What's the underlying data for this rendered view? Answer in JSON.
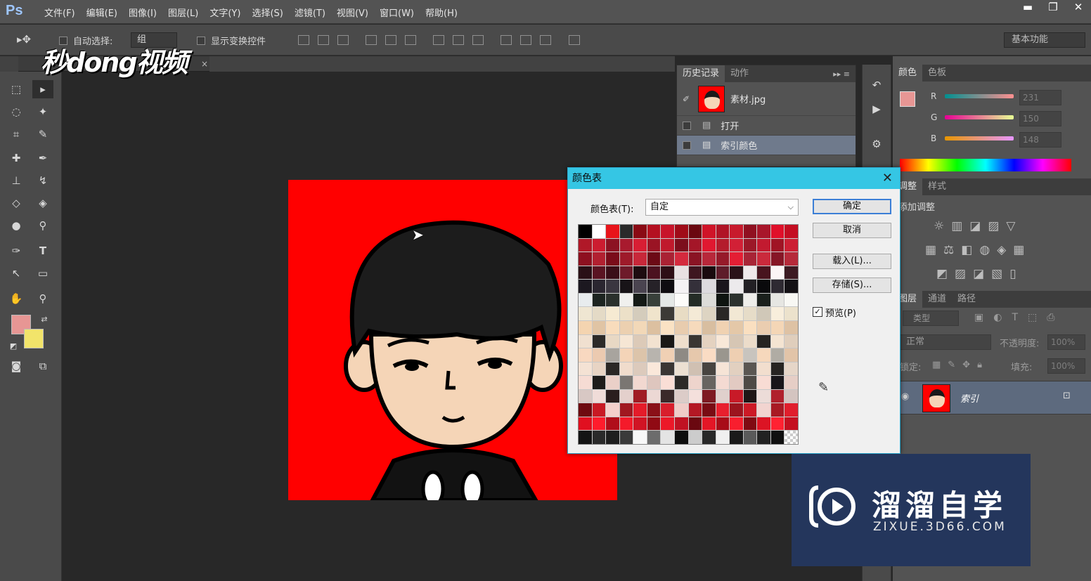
{
  "app": {
    "logo": "Ps",
    "menus": [
      "文件(F)",
      "编辑(E)",
      "图像(I)",
      "图层(L)",
      "文字(Y)",
      "选择(S)",
      "滤镜(T)",
      "视图(V)",
      "窗口(W)",
      "帮助(H)"
    ],
    "window_buttons": [
      "▬",
      "❐",
      "✕"
    ]
  },
  "options": {
    "auto_select_label": "自动选择:",
    "auto_select_value": "组",
    "show_transform_label": "显示变换控件",
    "workspace": "基本功能"
  },
  "watermark": "秒dong视频",
  "history_panel": {
    "tabs": [
      "历史记录",
      "动作"
    ],
    "snapshot": "素材.jpg",
    "items": [
      "打开",
      "索引颜色"
    ]
  },
  "color_panel": {
    "tabs": [
      "颜色",
      "色板"
    ],
    "channels": [
      {
        "label": "R",
        "value": "231"
      },
      {
        "label": "G",
        "value": "150"
      },
      {
        "label": "B",
        "value": "148"
      }
    ],
    "foreground": "#e79694",
    "background": "#f2e46a"
  },
  "adjust_panel": {
    "tabs": [
      "调整",
      "样式"
    ],
    "heading": "添加调整"
  },
  "layers_panel": {
    "tabs": [
      "图层",
      "通道",
      "路径"
    ],
    "filter_label": "类型",
    "blend_mode": "正常",
    "opacity_label": "不透明度:",
    "opacity_value": "100%",
    "lock_label": "锁定:",
    "fill_label": "填充:",
    "fill_value": "100%",
    "layer_name": "索引"
  },
  "dialog": {
    "title": "颜色表",
    "table_label": "颜色表(T):",
    "table_value": "自定",
    "buttons": {
      "ok": "确定",
      "cancel": "取消",
      "load": "载入(L)...",
      "save": "存储(S)..."
    },
    "preview_label": "预览(P)",
    "swatches": [
      "#000000",
      "#ffffff",
      "#e8141a",
      "#2a2a2a",
      "#8a0a14",
      "#b41020",
      "#c8142a",
      "#a00c18",
      "#6a0810",
      "#d01428",
      "#b01426",
      "#c81a2c",
      "#901020",
      "#a8162a",
      "#e0102a",
      "#c40e22",
      "#b01828",
      "#cc1c30",
      "#8c1222",
      "#a81a2e",
      "#d81e34",
      "#9a1424",
      "#c01a2c",
      "#7c0e1c",
      "#a41628",
      "#e01830",
      "#b41c2c",
      "#d22036",
      "#9c1828",
      "#c21a30",
      "#a01424",
      "#cc2034",
      "#8e1020",
      "#b22030",
      "#7a0c1a",
      "#9e1a2a",
      "#c8283a",
      "#6c0a16",
      "#aa2234",
      "#d42a3e",
      "#8a1424",
      "#b8283a",
      "#961a2a",
      "#e41e34",
      "#a82436",
      "#ca2a3c",
      "#861626",
      "#b62a3a",
      "#2a1016",
      "#5a1422",
      "#3a0e18",
      "#6e1a2a",
      "#1e0c10",
      "#4c1220",
      "#2e0e16",
      "#e8e0e2",
      "#3e1620",
      "#1a0a0e",
      "#5e1c2a",
      "#2a1218",
      "#f0e8ea",
      "#48141e",
      "#fbf5f6",
      "#3c1a22",
      "#1c1820",
      "#2a2630",
      "#3a3640",
      "#181418",
      "#4a4450",
      "#262228",
      "#0e0c10",
      "#f4f2f4",
      "#34303a",
      "#dcdade",
      "#1a161c",
      "#eceaec",
      "#222024",
      "#0a0a0c",
      "#2e2a32",
      "#141216",
      "#e8ecee",
      "#1c2420",
      "#2a302c",
      "#f0f0ee",
      "#141a16",
      "#38403a",
      "#e4e8e6",
      "#fcfcfa",
      "#242c26",
      "#dcdcd8",
      "#0e1410",
      "#2c322e",
      "#eeeeea",
      "#1a201c",
      "#e6e6e2",
      "#f8f8f4",
      "#efe6d2",
      "#e4dac6",
      "#f6ead2",
      "#ece0c8",
      "#d4ccbc",
      "#f0e4cc",
      "#3c3a36",
      "#e8dcc4",
      "#f4ead6",
      "#ddd4c2",
      "#2a2826",
      "#f2e8d4",
      "#e6dcc8",
      "#d0c8b8",
      "#f8eedc",
      "#ece2cc",
      "#f4d4b0",
      "#e0c4a4",
      "#f8dcbc",
      "#ecd0b0",
      "#f2d8b8",
      "#dcc0a0",
      "#fae2c4",
      "#e8ccae",
      "#f6dabc",
      "#d8bea0",
      "#f0d2b2",
      "#e4c8a8",
      "#fadfc0",
      "#eacdb0",
      "#f4d6b6",
      "#dec2a4",
      "#f0e0d0",
      "#2c2a28",
      "#e8d8c4",
      "#f6e6d4",
      "#dccab8",
      "#f2e2d0",
      "#1a1816",
      "#eedecc",
      "#3a3632",
      "#e4d2c0",
      "#f8e8d8",
      "#d6c6b4",
      "#ecdcca",
      "#262422",
      "#f4e4d2",
      "#e0cebc",
      "#f8d8c0",
      "#eccab0",
      "#a8a49e",
      "#f4d4b8",
      "#dcc4aa",
      "#b8b4ae",
      "#f0d0b4",
      "#8e8a84",
      "#e6c8ac",
      "#fadcc4",
      "#9a968e",
      "#eecfb2",
      "#c8c4be",
      "#f6d8bc",
      "#b0aca4",
      "#e2c4a8",
      "#f4e2d4",
      "#e8d4c4",
      "#2a2826",
      "#f0dccc",
      "#dccabc",
      "#fae8da",
      "#3a3634",
      "#ece0d2",
      "#d0c0b2",
      "#484440",
      "#f6e4d6",
      "#e2d0c0",
      "#5a5652",
      "#f2dece",
      "#262422",
      "#e6d6c8",
      "#f6dcd4",
      "#1e1c1a",
      "#ead0c8",
      "#7a7672",
      "#f2d8d0",
      "#dec6be",
      "#faded6",
      "#2c2a28",
      "#eed4cc",
      "#686460",
      "#f4dad2",
      "#e2cac2",
      "#4e4a46",
      "#f8dcd4",
      "#18161a",
      "#e6cec6",
      "#d8c8c4",
      "#f0dcd8",
      "#2a1e1e",
      "#e4d0cc",
      "#a01c24",
      "#ecd8d4",
      "#3a2a2a",
      "#dcccc8",
      "#f4e0dc",
      "#7e1a22",
      "#e0d0cc",
      "#c81a28",
      "#1e1616",
      "#ecdcd8",
      "#b0202c",
      "#d4c4c0",
      "#6e0a10",
      "#c81a24",
      "#f4d0cc",
      "#a01820",
      "#e41c2a",
      "#8a1018",
      "#d81e2c",
      "#f0ccc8",
      "#b41824",
      "#7a0c14",
      "#e8202e",
      "#9c141e",
      "#cc1a26",
      "#f2d4d0",
      "#a81a24",
      "#e01e2c",
      "#e01020",
      "#ff1c2c",
      "#b00e1a",
      "#f41a2a",
      "#d01424",
      "#900a14",
      "#ec1828",
      "#c01222",
      "#6a0810",
      "#e41626",
      "#a80c18",
      "#f81e2e",
      "#800a12",
      "#dc1424",
      "#ff2232",
      "#c41020",
      "#141414",
      "#2a2a2a",
      "#1e1e1e",
      "#3a3a3a",
      "#f8f8f8",
      "#6c6c6c",
      "#e4e4e4",
      "#0e0e0e",
      "#cccccc",
      "#282828",
      "#f0f0f0",
      "#1a1a1a",
      "#5a5a5a",
      "#222222",
      "#101010",
      "#e8e8e8"
    ]
  },
  "brand": {
    "name": "溜溜自学",
    "url": "ZIXUE.3D66.COM"
  }
}
